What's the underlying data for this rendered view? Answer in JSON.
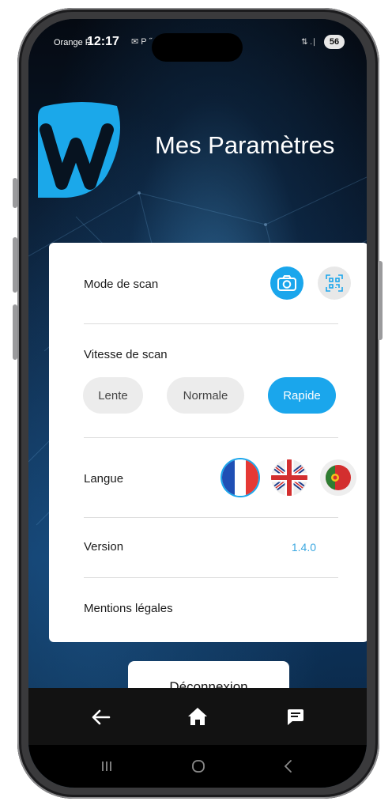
{
  "status_bar": {
    "carrier": "Orange F",
    "time": "12:17",
    "icons": "✉ P ˝",
    "network": "⇅ .∣",
    "battery": "56"
  },
  "header": {
    "title": "Mes Paramètres"
  },
  "settings": {
    "scan_mode": {
      "label": "Mode de scan",
      "options": [
        {
          "icon": "camera-icon",
          "selected": true
        },
        {
          "icon": "qr-scan-icon",
          "selected": false
        }
      ]
    },
    "scan_speed": {
      "label": "Vitesse de scan",
      "options": [
        {
          "label": "Lente",
          "selected": false
        },
        {
          "label": "Normale",
          "selected": false
        },
        {
          "label": "Rapide",
          "selected": true
        }
      ]
    },
    "language": {
      "label": "Langue",
      "options": [
        {
          "icon": "flag-france-icon",
          "selected": true
        },
        {
          "icon": "flag-uk-icon",
          "selected": false
        },
        {
          "icon": "flag-portugal-icon",
          "selected": false
        }
      ]
    },
    "version": {
      "label": "Version",
      "value": "1.4.0"
    },
    "legal": {
      "label": "Mentions légales"
    }
  },
  "logout_label": "Déconnexion",
  "app_nav": [
    {
      "icon": "back-arrow-icon"
    },
    {
      "icon": "home-icon"
    },
    {
      "icon": "chat-icon"
    }
  ],
  "system_nav": [
    {
      "icon": "recent-apps-icon"
    },
    {
      "icon": "system-home-icon"
    },
    {
      "icon": "system-back-icon"
    }
  ],
  "colors": {
    "accent": "#1aa6ec",
    "logo": "#1ba8ea",
    "version_text": "#3aa7e0"
  }
}
